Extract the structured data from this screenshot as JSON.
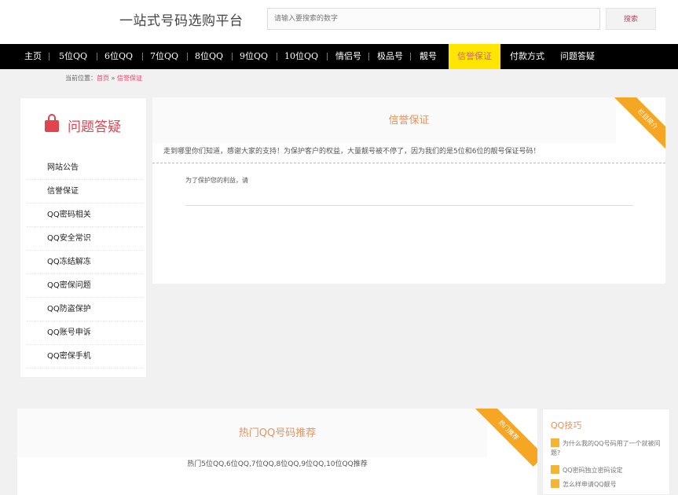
{
  "header": {
    "site_title": "一站式号码选购平台",
    "search_placeholder": "请输入要搜索的数字",
    "search_button": "搜索"
  },
  "nav": {
    "items": [
      {
        "label": "主页"
      },
      {
        "label": "5位QQ"
      },
      {
        "label": "6位QQ"
      },
      {
        "label": "7位QQ"
      },
      {
        "label": "8位QQ"
      },
      {
        "label": "9位QQ"
      },
      {
        "label": "10位QQ"
      },
      {
        "label": "情侣号"
      },
      {
        "label": "极品号"
      },
      {
        "label": "靓号"
      },
      {
        "label": "信誉保证"
      },
      {
        "label": "付款方式"
      },
      {
        "label": "问题答疑"
      }
    ],
    "active": "信誉保证"
  },
  "breadcrumb": {
    "prefix": "当前位置：",
    "home": "首页",
    "sep": " » ",
    "current": "信誉保证"
  },
  "sidebar": {
    "title": "问题答疑",
    "items": [
      {
        "label": "网站公告"
      },
      {
        "label": "信誉保证"
      },
      {
        "label": "QQ密码相关"
      },
      {
        "label": "QQ安全常识"
      },
      {
        "label": "QQ冻结解冻"
      },
      {
        "label": "QQ密保问题"
      },
      {
        "label": "QQ防盗保护"
      },
      {
        "label": "QQ账号申诉"
      },
      {
        "label": "QQ密保手机"
      }
    ]
  },
  "content": {
    "title": "信誉保证",
    "ribbon": "栏目简介",
    "intro": "走到哪里你们知道，感谢大家的支持！为保护客户的权益，大量靓号被不停了，因为我们的是5位和6位的靓号保证号码！",
    "body": "为了保护您的利益，请"
  },
  "hot": {
    "title": "热门QQ号码推荐",
    "ribbon": "热门推荐",
    "desc": "热门5位QQ,6位QQ,7位QQ,8位QQ,9位QQ,10位QQ推荐"
  },
  "tips": {
    "title": "QQ技巧",
    "items": [
      {
        "label": "为什么我的QQ号码用了一个就被问题?"
      },
      {
        "label": "QQ密码独立密码设定"
      },
      {
        "label": "怎么样申请QQ靓号"
      }
    ]
  }
}
